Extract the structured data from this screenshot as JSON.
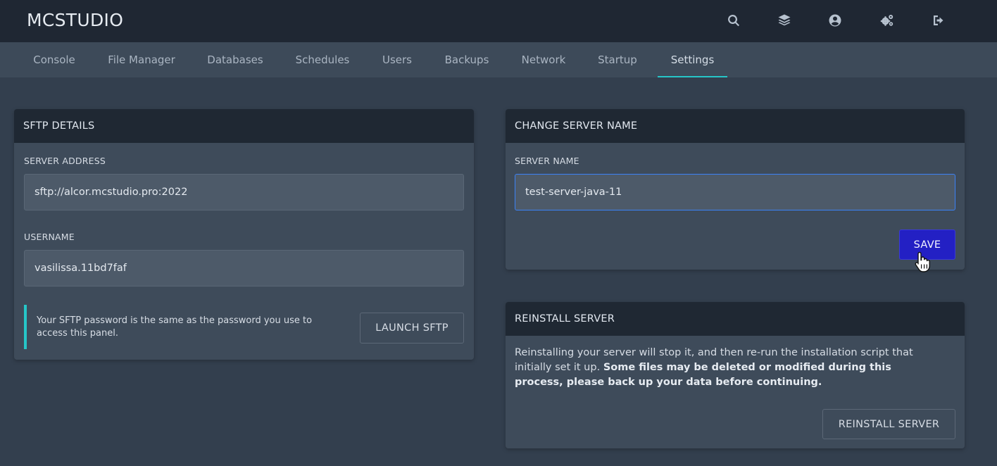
{
  "app": {
    "brand": "MCSTUDIO"
  },
  "header_icons": [
    "search-icon",
    "layers-icon",
    "user-circle-icon",
    "cogs-icon",
    "sign-out-icon"
  ],
  "tabs": [
    {
      "label": "Console",
      "active": false
    },
    {
      "label": "File Manager",
      "active": false
    },
    {
      "label": "Databases",
      "active": false
    },
    {
      "label": "Schedules",
      "active": false
    },
    {
      "label": "Users",
      "active": false
    },
    {
      "label": "Backups",
      "active": false
    },
    {
      "label": "Network",
      "active": false
    },
    {
      "label": "Startup",
      "active": false
    },
    {
      "label": "Settings",
      "active": true
    }
  ],
  "sftp": {
    "title": "SFTP DETAILS",
    "address_label": "SERVER ADDRESS",
    "address_value": "sftp://alcor.mcstudio.pro:2022",
    "username_label": "USERNAME",
    "username_value": "vasilissa.11bd7faf",
    "note": "Your SFTP password is the same as the password you use to access this panel.",
    "launch_label": "LAUNCH SFTP"
  },
  "server_name": {
    "title": "CHANGE SERVER NAME",
    "label": "SERVER NAME",
    "value": "test-server-java-11",
    "save_label": "SAVE"
  },
  "reinstall": {
    "title": "REINSTALL SERVER",
    "text": "Reinstalling your server will stop it, and then re-run the installation script that initially set it up.",
    "warning": "Some files may be deleted or modified during this process, please back up your data before continuing.",
    "button_label": "REINSTALL SERVER"
  },
  "colors": {
    "accent": "#26c6c8",
    "primary_button": "#2320c4",
    "background": "#333f4e",
    "header": "#1f2733"
  }
}
